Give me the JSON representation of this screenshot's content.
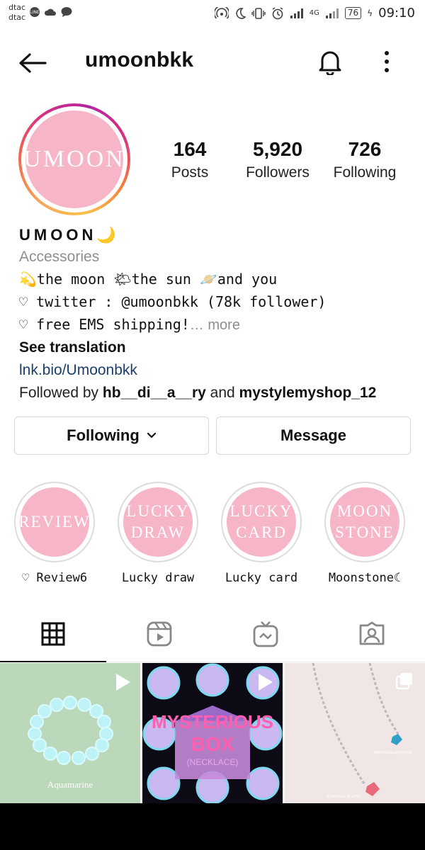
{
  "status_bar": {
    "carrier_1": "dtac",
    "carrier_2": "dtac",
    "network": "4G",
    "battery": "76",
    "time": "09:10"
  },
  "header": {
    "username": "umoonbkk",
    "back_icon": "back-arrow-icon",
    "notification_icon": "bell-icon",
    "menu_icon": "more-vertical-icon"
  },
  "profile": {
    "avatar_text": "UMOON",
    "stats": [
      {
        "value": "164",
        "label": "Posts"
      },
      {
        "value": "5,920",
        "label": "Followers"
      },
      {
        "value": "726",
        "label": "Following"
      }
    ],
    "name": "UMOON🌙",
    "category": "Accessories",
    "bio_lines": [
      "💫the moon 🌤the sun 🪐and you",
      "♡ twitter : @umoonbkk (78k follower)",
      "♡ free EMS shipping!"
    ],
    "more": "… more",
    "see_translation": "See translation",
    "link": "lnk.bio/Umoonbkk",
    "followed_by_prefix": "Followed by ",
    "followed_by_user1": "hb__di__a__ry",
    "followed_by_and": " and ",
    "followed_by_user2": "mystylemyshop_12"
  },
  "buttons": {
    "following": "Following",
    "message": "Message"
  },
  "highlights": [
    {
      "cover_line1": "REVIEW",
      "cover_line2": "",
      "label": "♡ Review6"
    },
    {
      "cover_line1": "LUCKY",
      "cover_line2": "DRAW",
      "label": "Lucky draw"
    },
    {
      "cover_line1": "LUCKY",
      "cover_line2": "CARD",
      "label": "Lucky card"
    },
    {
      "cover_line1": "MOON",
      "cover_line2": "STONE",
      "label": "Moonstone☾"
    }
  ],
  "tabs": [
    "grid-icon",
    "reels-icon",
    "igtv-icon",
    "tagged-icon"
  ],
  "posts": [
    {
      "caption": "Aquamarine",
      "badge": "reel-play-icon"
    },
    {
      "title1": "MYSTERIOUS",
      "title2": "BOX",
      "subtitle": "(NECKLACE)",
      "badge": "reel-play-icon"
    },
    {
      "caption1": "Aden/aquamarine",
      "caption2": "Eve/rose quartz",
      "badge": "carousel-icon"
    }
  ],
  "colors": {
    "brand_pink": "#f7b6c8",
    "link_blue": "#1a3f6e"
  }
}
